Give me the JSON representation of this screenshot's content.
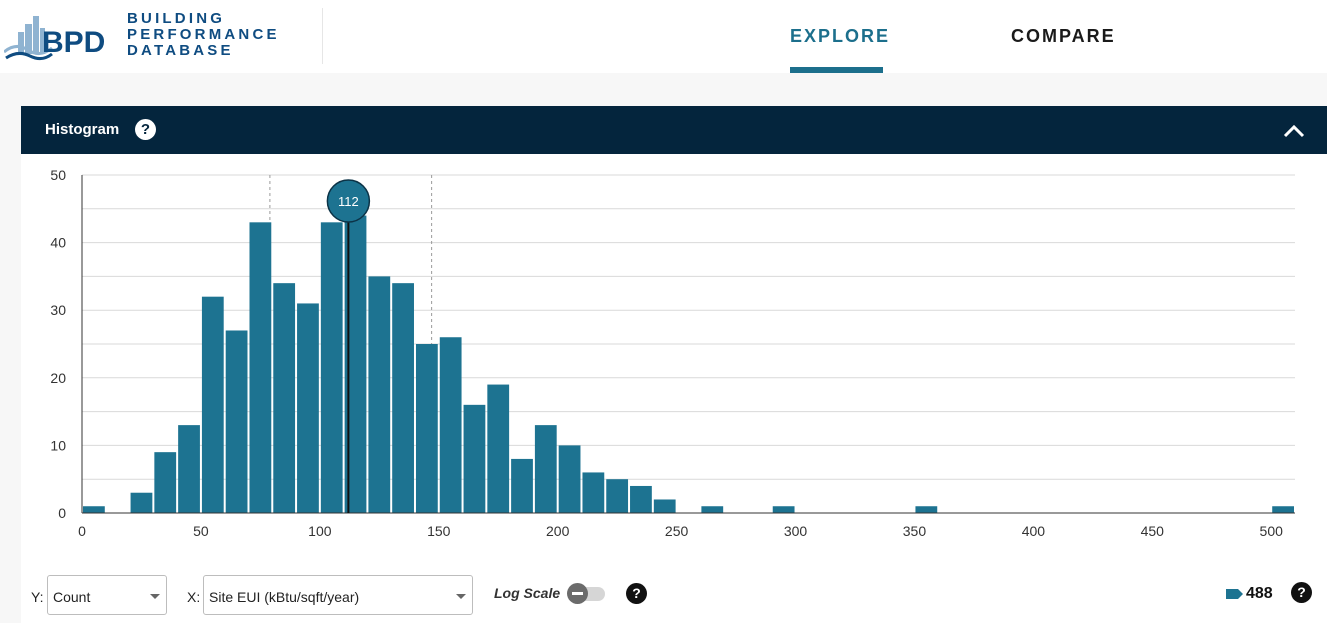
{
  "header": {
    "logo_abbr": "BPD",
    "logo_lines": [
      "BUILDING",
      "PERFORMANCE",
      "DATABASE"
    ],
    "nav": {
      "explore": "EXPLORE",
      "compare": "COMPARE",
      "active": "explore"
    },
    "colors": {
      "brand": "#0f4c81",
      "accent": "#1c6f8c"
    }
  },
  "panel": {
    "title": "Histogram",
    "help_icon": "?",
    "collapse_icon": "chevron-up-icon",
    "header_color": "#04253d"
  },
  "chart_data": {
    "type": "bar",
    "title": "",
    "xlabel": "",
    "ylabel": "",
    "bar_color": "#1d7391",
    "bin_width": 10,
    "x": [
      0,
      20,
      30,
      40,
      50,
      60,
      70,
      80,
      90,
      100,
      110,
      120,
      130,
      140,
      150,
      160,
      170,
      180,
      190,
      200,
      210,
      220,
      230,
      240,
      260,
      290,
      350,
      500
    ],
    "values": [
      1,
      3,
      9,
      13,
      32,
      27,
      43,
      34,
      31,
      43,
      44,
      35,
      34,
      25,
      26,
      16,
      19,
      8,
      13,
      10,
      6,
      5,
      4,
      2,
      1,
      1,
      1,
      1
    ],
    "xlim": [
      0,
      510
    ],
    "ylim": [
      0,
      50
    ],
    "x_ticks": [
      "0",
      "50",
      "100",
      "150",
      "200",
      "250",
      "300",
      "350",
      "400",
      "450",
      "500"
    ],
    "y_ticks": [
      "0",
      "10",
      "20",
      "30",
      "40",
      "50"
    ],
    "grid": true,
    "median": 112,
    "median_label": "112",
    "quartile_lines": [
      79,
      147
    ]
  },
  "controls": {
    "y_label": "Y:",
    "y_value": "Count",
    "x_label": "X:",
    "x_value": "Site EUI (kBtu/sqft/year)",
    "log_scale_label": "Log Scale",
    "log_scale_on": false,
    "help_icon": "?",
    "count": "488"
  }
}
